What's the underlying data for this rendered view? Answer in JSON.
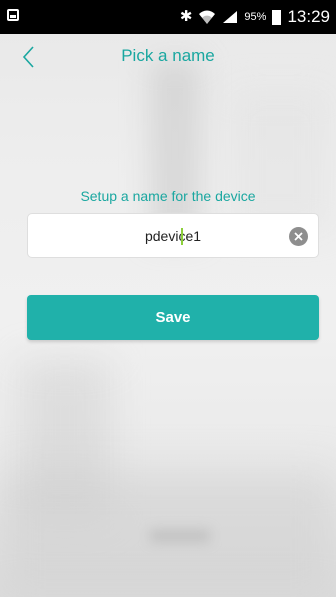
{
  "status_bar": {
    "battery_percent": "95%",
    "time": "13:29",
    "icons": [
      "gallery-notification-icon",
      "bluetooth-icon",
      "wifi-icon",
      "signal-icon",
      "battery-icon"
    ]
  },
  "header": {
    "back_icon": "chevron-left-icon",
    "title": "Pick a name"
  },
  "form": {
    "prompt": "Setup a name for the device",
    "name_value": "pdevice1",
    "clear_icon": "clear-circle-icon",
    "save_label": "Save"
  },
  "colors": {
    "accent": "#1aa7a0",
    "button": "#20b1aa",
    "caret": "#8ccf3b"
  }
}
